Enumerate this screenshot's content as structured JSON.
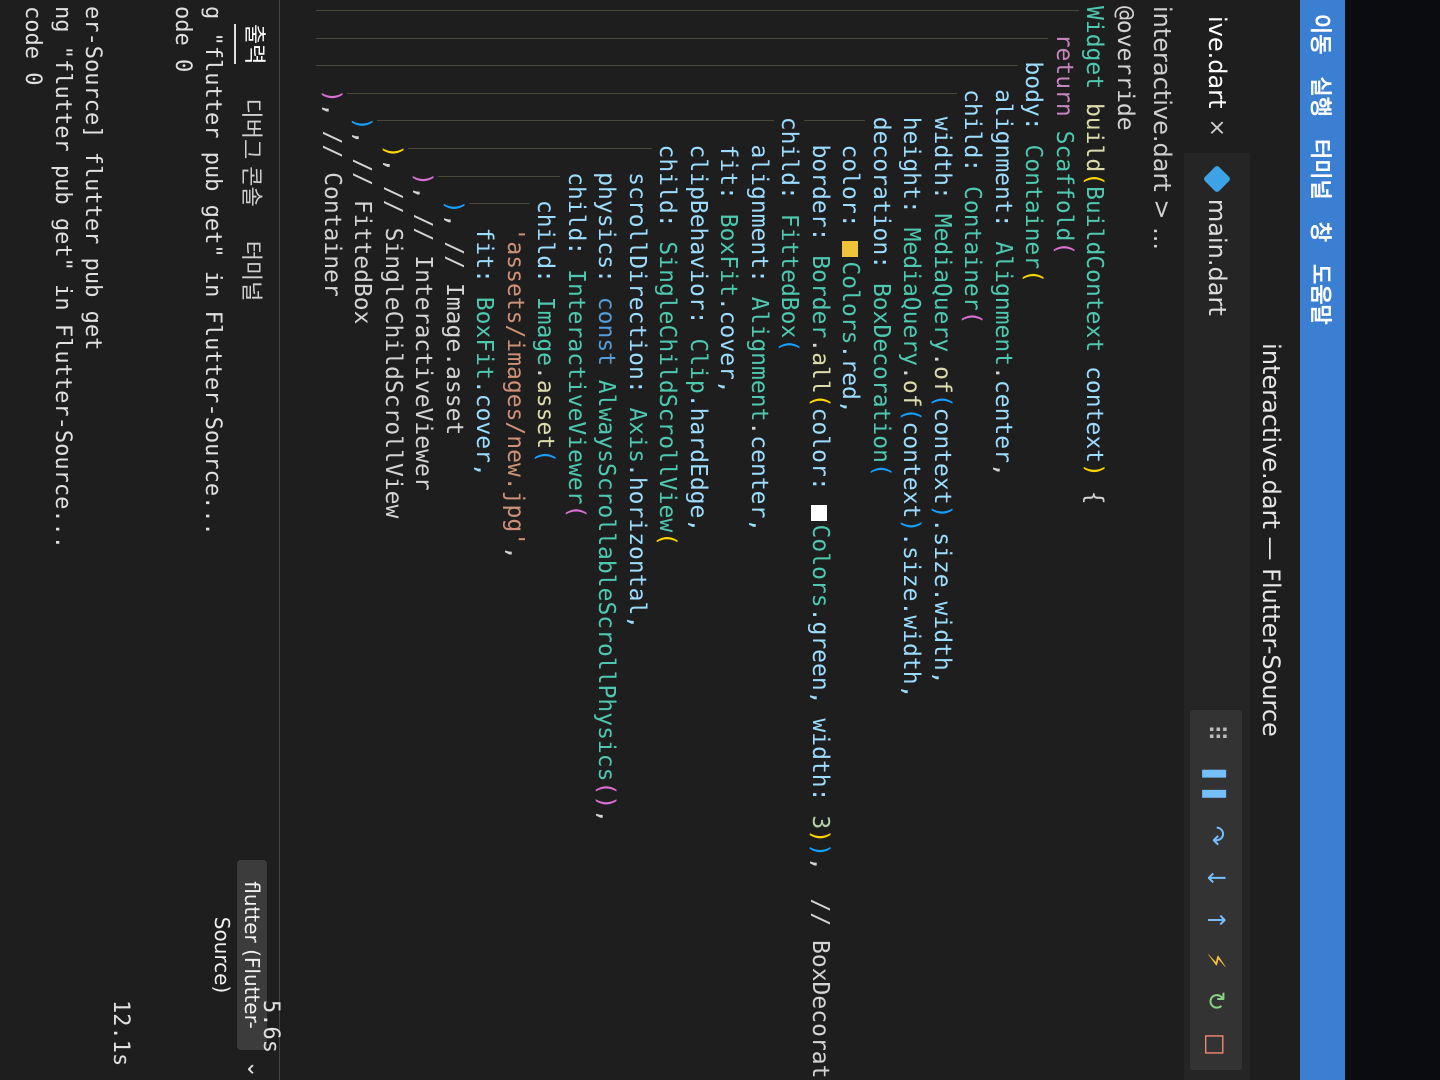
{
  "menubar": [
    "이동",
    "실행",
    "터미널",
    "창",
    "도움말"
  ],
  "window_title": "interactive.dart — Flutter-Source",
  "tabs": [
    {
      "label": "ive.dart",
      "close": "×"
    },
    {
      "label": "main.dart"
    }
  ],
  "debug_toolbar": {
    "icons": [
      "drag-handle-icon",
      "pause-icon",
      "step-over-icon",
      "step-into-icon",
      "step-out-icon",
      "hot-reload-icon",
      "restart-icon",
      "stop-icon"
    ],
    "glyphs": [
      "⠿",
      "❚❚",
      "↷",
      "↓",
      "↑",
      "⚡",
      "↻",
      "□"
    ],
    "colors": {
      "default": "#75beff",
      "hot_reload": "#f6c23e",
      "restart": "#89d185",
      "stop": "#f48771"
    }
  },
  "breadcrumb": "interactive.dart > ...",
  "code_lines": [
    [
      [
        "@override",
        "#d4d4d4"
      ]
    ],
    [
      [
        "Widget",
        "#4ec9b0"
      ],
      [
        " ",
        "#d4d4d4"
      ],
      [
        "build",
        "#dcdcaa"
      ],
      [
        "(",
        "#ffd700"
      ],
      [
        "BuildContext",
        "#4ec9b0"
      ],
      [
        " context",
        "#9cdcfe"
      ],
      [
        ")",
        "#ffd700"
      ],
      [
        " {",
        "#d4d4d4"
      ]
    ],
    [
      [
        "  return",
        "#c586c0"
      ],
      [
        " Scaffold",
        "#4ec9b0"
      ],
      [
        "(",
        "#da70d6"
      ]
    ],
    [
      [
        "    body: ",
        "#9cdcfe"
      ],
      [
        "Container",
        "#4ec9b0"
      ],
      [
        "(",
        "#ffd700"
      ]
    ],
    [
      [
        "      alignment: ",
        "#9cdcfe"
      ],
      [
        "Alignment",
        "#4ec9b0"
      ],
      [
        ".",
        "#d4d4d4"
      ],
      [
        "center",
        "#9cdcfe"
      ],
      [
        ",",
        "#d4d4d4"
      ]
    ],
    [
      [
        "      child: ",
        "#9cdcfe"
      ],
      [
        "Container",
        "#4ec9b0"
      ],
      [
        "(",
        "#da70d6"
      ]
    ],
    [
      [
        "        width: ",
        "#9cdcfe"
      ],
      [
        "MediaQuery",
        "#4ec9b0"
      ],
      [
        ".",
        "#d4d4d4"
      ],
      [
        "of",
        "#dcdcaa"
      ],
      [
        "(",
        "#179fff"
      ],
      [
        "context",
        "#9cdcfe"
      ],
      [
        ")",
        "#179fff"
      ],
      [
        ".size.width,",
        "#9cdcfe"
      ]
    ],
    [
      [
        "        height: ",
        "#9cdcfe"
      ],
      [
        "MediaQuery",
        "#4ec9b0"
      ],
      [
        ".",
        "#d4d4d4"
      ],
      [
        "of",
        "#dcdcaa"
      ],
      [
        "(",
        "#179fff"
      ],
      [
        "context",
        "#9cdcfe"
      ],
      [
        ")",
        "#179fff"
      ],
      [
        ".size.width,",
        "#9cdcfe"
      ]
    ],
    [
      [
        "        decoration: ",
        "#9cdcfe"
      ],
      [
        "BoxDecoration",
        "#4ec9b0"
      ],
      [
        "(",
        "#179fff"
      ]
    ],
    [
      [
        "          color: ",
        "#9cdcfe"
      ],
      [
        "SW:#f0c33b",
        ""
      ],
      [
        "Colors",
        "#4ec9b0"
      ],
      [
        ".red,",
        "#9cdcfe"
      ]
    ],
    [
      [
        "          border: ",
        "#9cdcfe"
      ],
      [
        "Border",
        "#4ec9b0"
      ],
      [
        ".",
        "#d4d4d4"
      ],
      [
        "all",
        "#dcdcaa"
      ],
      [
        "(",
        "#ffd700"
      ],
      [
        "color: ",
        "#9cdcfe"
      ],
      [
        "SW:#ffffff",
        ""
      ],
      [
        "Colors",
        "#4ec9b0"
      ],
      [
        ".green, width: ",
        "#9cdcfe"
      ],
      [
        "3",
        "#b5cea8"
      ],
      [
        ")",
        "#ffd700"
      ],
      [
        ")",
        "#179fff"
      ],
      [
        ",  // BoxDecoration",
        "#d4d4d4"
      ]
    ],
    [
      [
        "        child: ",
        "#9cdcfe"
      ],
      [
        "FittedBox",
        "#4ec9b0"
      ],
      [
        "(",
        "#179fff"
      ]
    ],
    [
      [
        "          alignment: ",
        "#9cdcfe"
      ],
      [
        "Alignment",
        "#4ec9b0"
      ],
      [
        ".",
        "#d4d4d4"
      ],
      [
        "center,",
        "#9cdcfe"
      ]
    ],
    [
      [
        "          fit: ",
        "#9cdcfe"
      ],
      [
        "BoxFit",
        "#4ec9b0"
      ],
      [
        ".cover,",
        "#9cdcfe"
      ]
    ],
    [
      [
        "          clipBehavior: ",
        "#9cdcfe"
      ],
      [
        "Clip",
        "#4ec9b0"
      ],
      [
        ".hardEdge,",
        "#9cdcfe"
      ]
    ],
    [
      [
        "          child: ",
        "#9cdcfe"
      ],
      [
        "SingleChildScrollView",
        "#4ec9b0"
      ],
      [
        "(",
        "#ffd700"
      ]
    ],
    [
      [
        "            scrollDirection: ",
        "#9cdcfe"
      ],
      [
        "Axis",
        "#4ec9b0"
      ],
      [
        ".horizontal,",
        "#9cdcfe"
      ]
    ],
    [
      [
        "            physics: ",
        "#9cdcfe"
      ],
      [
        "const",
        "#569cd6"
      ],
      [
        " AlwaysScrollableScrollPhysics",
        "#4ec9b0"
      ],
      [
        "(",
        "#da70d6"
      ],
      [
        ")",
        "#da70d6"
      ],
      [
        ",",
        "#d4d4d4"
      ]
    ],
    [
      [
        "            child: ",
        "#9cdcfe"
      ],
      [
        "InteractiveViewer",
        "#4ec9b0"
      ],
      [
        "(",
        "#da70d6"
      ]
    ],
    [
      [
        "              child: ",
        "#9cdcfe"
      ],
      [
        "Image",
        "#4ec9b0"
      ],
      [
        ".",
        "#d4d4d4"
      ],
      [
        "asset",
        "#dcdcaa"
      ],
      [
        "(",
        "#179fff"
      ]
    ],
    [
      [
        "                'assets/images/new.jpg'",
        "#ce9178"
      ],
      [
        ",",
        "#d4d4d4"
      ]
    ],
    [
      [
        "                fit: ",
        "#9cdcfe"
      ],
      [
        "BoxFit",
        "#4ec9b0"
      ],
      [
        ".cover,",
        "#9cdcfe"
      ]
    ],
    [
      [
        "              )",
        "#179fff"
      ],
      [
        ", // Image.asset",
        "#d4d4d4"
      ]
    ],
    [
      [
        "            )",
        "#da70d6"
      ],
      [
        ", // InteractiveViewer",
        "#d4d4d4"
      ]
    ],
    [
      [
        "          )",
        "#ffd700"
      ],
      [
        ", // SingleChildScrollView",
        "#d4d4d4"
      ]
    ],
    [
      [
        "        )",
        "#179fff"
      ],
      [
        ", // FittedBox",
        "#d4d4d4"
      ]
    ],
    [
      [
        "      )",
        "#da70d6"
      ],
      [
        ", // Container",
        "#d4d4d4"
      ]
    ]
  ],
  "panel": {
    "tabs": [
      "출력",
      "디버그 콘솔",
      "터미널"
    ],
    "active_tab": 0,
    "dropdown": "flutter (Flutter-Source)",
    "output": [
      {
        "text": "g \"flutter pub get\" in Flutter-Source...",
        "time": "5.6s"
      },
      {
        "text": "ode 0",
        "time": ""
      },
      {
        "text": "",
        "time": ""
      },
      {
        "text": "",
        "time": ""
      },
      {
        "text": "er-Source] flutter pub get",
        "time": ""
      },
      {
        "text": "ng \"flutter pub get\" in Flutter-Source...",
        "time": "12.1s"
      },
      {
        "text": "code 0",
        "time": ""
      }
    ]
  }
}
